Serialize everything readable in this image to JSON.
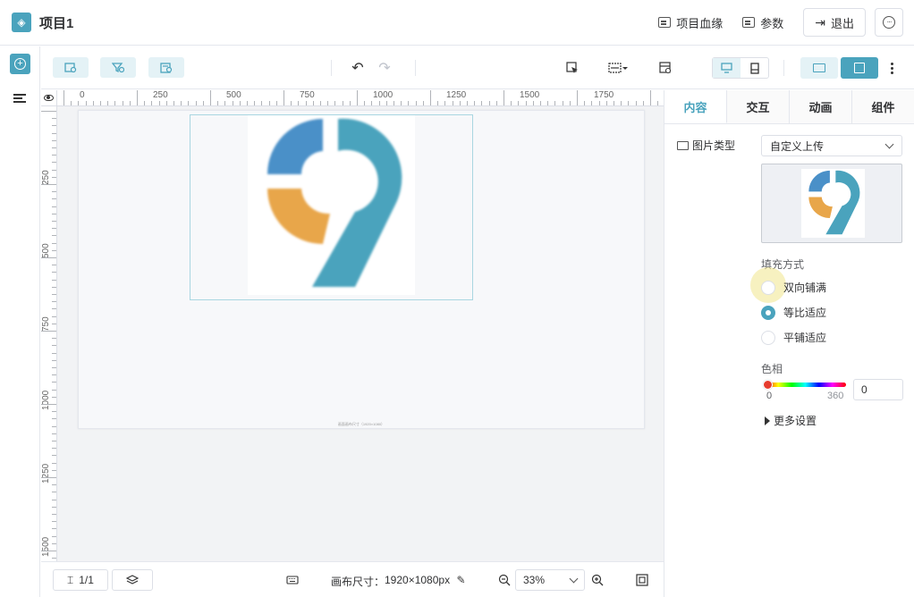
{
  "header": {
    "title": "项目1",
    "lineage_label": "项目血缘",
    "params_label": "参数",
    "exit_label": "退出"
  },
  "rulers": {
    "top_labels": [
      "0",
      "250",
      "500",
      "750",
      "1000",
      "1250",
      "1500",
      "1750"
    ],
    "left_labels": [
      "250",
      "500",
      "750",
      "1000",
      "1250",
      "1500"
    ]
  },
  "canvas": {
    "caption": "画面画布尺寸（1920×1080）"
  },
  "bottom": {
    "page_indicator": "1/1",
    "canvas_size_label": "画布尺寸：",
    "canvas_size_value": "1920×1080px",
    "zoom": "33%"
  },
  "panel": {
    "tabs": [
      "内容",
      "交互",
      "动画",
      "组件"
    ],
    "image_type_label": "图片类型",
    "image_type_value": "自定义上传",
    "fill_mode_title": "填充方式",
    "fill_options": [
      "双向铺满",
      "等比适应",
      "平铺适应"
    ],
    "fill_selected": "等比适应",
    "hue_title": "色相",
    "hue_min": "0",
    "hue_max": "360",
    "hue_value": "0",
    "more_settings": "更多设置"
  },
  "colors": {
    "accent": "#4aa3bd",
    "logo_blue": "#4a90c8",
    "logo_orange": "#e8a64a",
    "logo_teal": "#4aa3bd",
    "hue_knob": "#e63c2e"
  }
}
